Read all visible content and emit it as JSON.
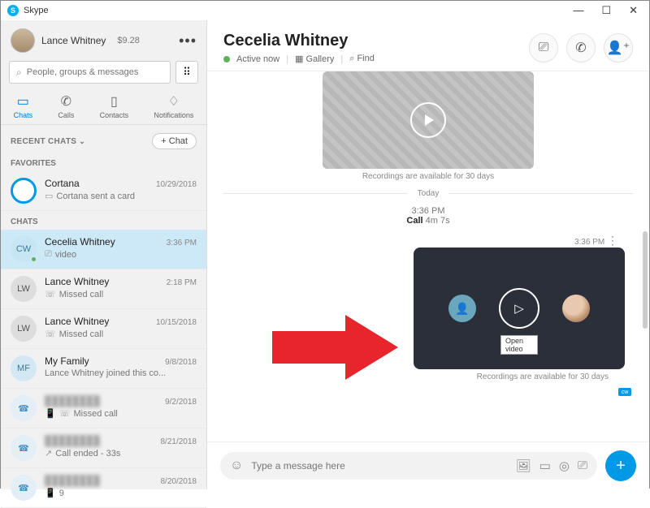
{
  "window": {
    "title": "Skype"
  },
  "profile": {
    "name": "Lance Whitney",
    "credit": "$9.28"
  },
  "search": {
    "placeholder": "People, groups & messages"
  },
  "tabs": [
    {
      "label": "Chats",
      "active": true
    },
    {
      "label": "Calls",
      "active": false
    },
    {
      "label": "Contacts",
      "active": false
    },
    {
      "label": "Notifications",
      "active": false
    }
  ],
  "sections": {
    "recent": "RECENT CHATS",
    "favorites": "FAVORITES",
    "chats": "CHATS",
    "newchat": "Chat"
  },
  "favorites": [
    {
      "name": "Cortana",
      "time": "10/29/2018",
      "sub": "Cortana sent a card"
    }
  ],
  "chats": [
    {
      "initials": "CW",
      "name": "Cecelia Whitney",
      "time": "3:36 PM",
      "sub": "video",
      "selected": true,
      "presence": true
    },
    {
      "initials": "LW",
      "name": "Lance Whitney",
      "time": "2:18 PM",
      "sub": "Missed call"
    },
    {
      "initials": "LW",
      "name": "Lance Whitney",
      "time": "10/15/2018",
      "sub": "Missed call"
    },
    {
      "initials": "MF",
      "name": "My Family",
      "time": "9/8/2018",
      "sub": "Lance Whitney joined this co..."
    },
    {
      "initials": "",
      "name": "",
      "time": "9/2/2018",
      "sub": "Missed call",
      "phone": true,
      "blurred": true
    },
    {
      "initials": "",
      "name": "",
      "time": "8/21/2018",
      "sub": "Call ended - 33s",
      "phone": true,
      "blurred": true
    },
    {
      "initials": "",
      "name": "",
      "time": "8/20/2018",
      "sub": "9",
      "phone": true,
      "blurred": true
    }
  ],
  "conversation": {
    "title": "Cecelia Whitney",
    "status": "Active now",
    "gallery": "Gallery",
    "find": "Find",
    "recording_note": "Recordings are available for 30 days",
    "divider": "Today",
    "call_time": "3:36 PM",
    "call_label": "Call",
    "call_duration": "4m 7s",
    "msg_time": "3:36 PM",
    "open_video_tooltip": "Open video",
    "read_initials": "cw"
  },
  "composer": {
    "placeholder": "Type a message here"
  }
}
